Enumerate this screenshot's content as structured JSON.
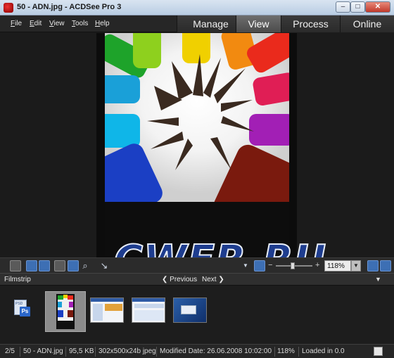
{
  "window": {
    "title": "50 - ADN.jpg - ACDSee Pro 3",
    "controls": {
      "minimize": "–",
      "maximize": "□",
      "close": "✕"
    }
  },
  "menu": {
    "items": [
      {
        "label": "File",
        "accel": "F",
        "rest": "ile"
      },
      {
        "label": "Edit",
        "accel": "E",
        "rest": "dit"
      },
      {
        "label": "View",
        "accel": "V",
        "rest": "iew"
      },
      {
        "label": "Tools",
        "accel": "T",
        "rest": "ools"
      },
      {
        "label": "Help",
        "accel": "H",
        "rest": "elp"
      }
    ]
  },
  "modes": {
    "tabs": [
      "Manage",
      "View",
      "Process",
      "Online"
    ],
    "active": "View"
  },
  "viewer": {
    "overlay_text": "CWER.RU"
  },
  "zoom": {
    "minus": "−",
    "plus": "+",
    "value": "118%",
    "dropdown": "▼",
    "level": 0.45
  },
  "filmstrip": {
    "title": "Filmstrip",
    "previous": "Previous",
    "next": "Next",
    "prev_arrow": "❮",
    "next_arrow": "❯",
    "collapse": "▼",
    "psd_label": "PSD",
    "ps_badge": "Ps"
  },
  "status": {
    "position": "2/5",
    "filename": "50 - ADN.jpg",
    "filesize": "95,5 KB",
    "dimensions": "302x500x24b jpeg",
    "modified": "Modified Date: 26.06.2008 10:02:00",
    "zoom": "118%",
    "loaded": "Loaded in 0.0"
  },
  "icons": {
    "app": "acdsee-app-icon",
    "toolbar": [
      "filmstrip-view-icon",
      "rotate-left-icon",
      "rotate-right-icon",
      "hand-pan-icon",
      "select-icon",
      "magnifier-icon",
      "fit-icon"
    ],
    "right": [
      "auto-lens-icon",
      "fullscreen-icon"
    ]
  },
  "colors": {
    "accent": "#3d6fb4",
    "active_tab": "#5a5a5a",
    "background": "#1c1c1c"
  }
}
